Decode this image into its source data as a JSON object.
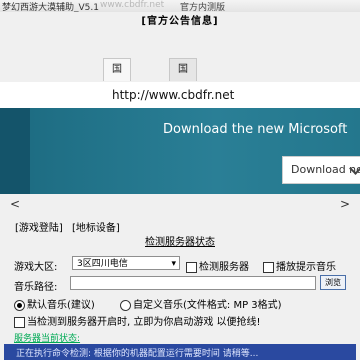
{
  "window": {
    "title_left": "梦幻西游大漠辅助_V5.1",
    "watermark": "www.cbdfr.net",
    "title_right": "官方内测版"
  },
  "notice": {
    "title": "[官方公告信息]"
  },
  "tabs": [
    {
      "label": "国内版",
      "active": true
    },
    {
      "label": "国际版",
      "active": false
    }
  ],
  "browser": {
    "url_peek": "http://www.cbdfr.net",
    "banner_text": "Download the new Microsoft",
    "download_button": "Download now",
    "nav_prev": "<",
    "nav_next": ">"
  },
  "links": [
    "[游戏登陆]",
    "[地标设备]"
  ],
  "server_section": {
    "title": "检测服务器状态",
    "game_area_label": "游戏大区:",
    "game_area_value": "3区四川电信",
    "check_server_label": "检测服务器",
    "play_sound_label": "播放提示音乐",
    "music_path_label": "音乐路径:",
    "music_path_value": "",
    "browse_label": "浏览",
    "radio_default": "默认音乐(建议)",
    "radio_custom": "自定义音乐(文件格式: MP 3格式)",
    "auto_start_label": "当检测到服务器开启时, 立即为你启动游戏 以便抢线!",
    "status_label": "服务器当前状态:",
    "status_text": "正在执行命令检测: 根据你的机器配置运行需要时间 请稍等..."
  }
}
